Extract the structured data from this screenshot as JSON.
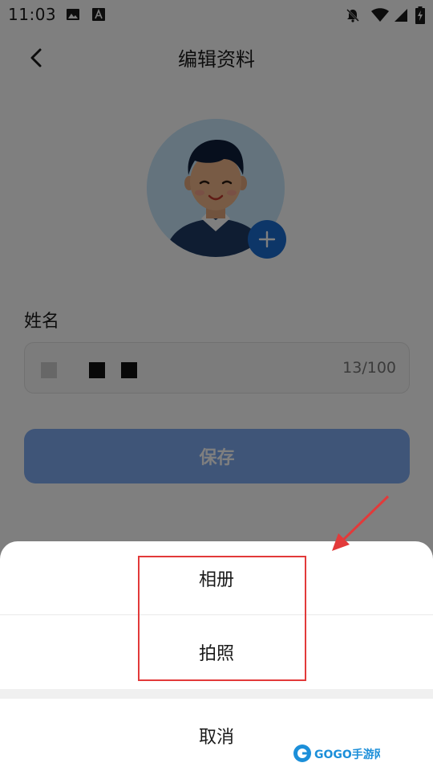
{
  "status_bar": {
    "time": "11:03"
  },
  "header": {
    "title": "编辑资料"
  },
  "form": {
    "name_label": "姓名",
    "char_count": "13/100",
    "save_label": "保存"
  },
  "sheet": {
    "album_label": "相册",
    "photo_label": "拍照",
    "cancel_label": "取消"
  },
  "watermark": {
    "text": "GOGO手游网"
  },
  "colors": {
    "accent": "#1b6dd1",
    "save_button": "#7faaf0",
    "annotation": "#e23a3a"
  }
}
